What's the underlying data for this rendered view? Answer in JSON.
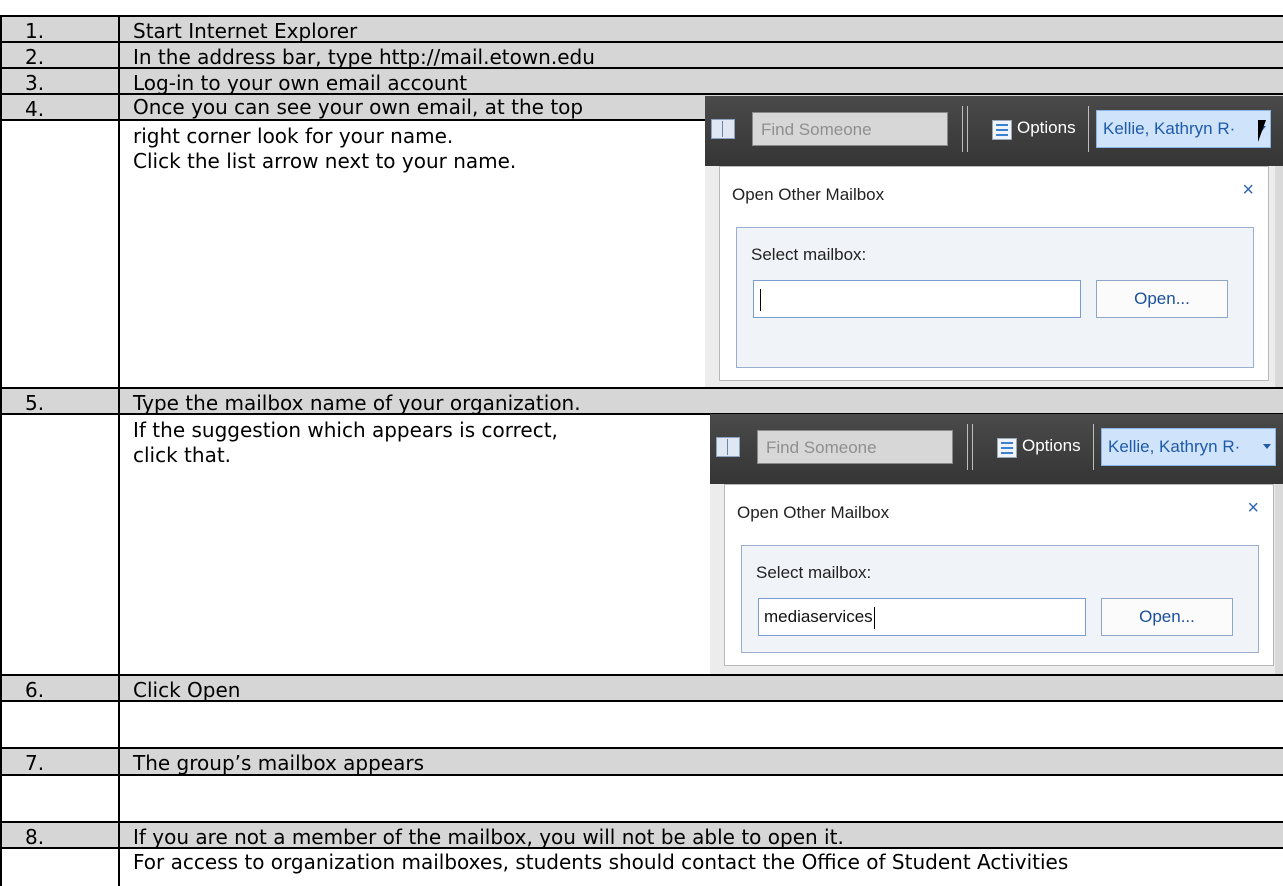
{
  "steps": [
    {
      "number": "1.",
      "lines": [
        "Start Internet Explorer"
      ]
    },
    {
      "number": "2.",
      "lines": [
        "In the address bar, type  http://mail.etown.edu"
      ]
    },
    {
      "number": "3.",
      "lines": [
        "Log-in to your own email account"
      ]
    },
    {
      "number": "4.",
      "lines": [
        "Once you can see your own email, at the top",
        "right corner look for your name.",
        "Click the list arrow next to your name."
      ]
    },
    {
      "number": "5.",
      "lines": [
        "Type the mailbox name of your organization.",
        "If the suggestion which appears is correct,",
        "click that."
      ]
    },
    {
      "number": "6.",
      "lines": [
        "Click Open"
      ]
    },
    {
      "number": "7.",
      "lines": [
        "The group’s mailbox appears"
      ]
    },
    {
      "number": "8.",
      "lines": [
        "If you are not a member of the mailbox, you will not be able to open it.",
        "For access to organization mailboxes, students should contact the Office of Student Activities"
      ]
    }
  ],
  "screenshots": [
    {
      "find_placeholder": "Find Someone",
      "options_label": "Options",
      "user_name": "Kellie, Kathryn R·",
      "dialog_title": "Open Other Mailbox",
      "close_glyph": "×",
      "select_label": "Select mailbox:",
      "mailbox_value": "",
      "open_button": "Open..."
    },
    {
      "find_placeholder": "Find Someone",
      "options_label": "Options",
      "user_name": "Kellie, Kathryn R·",
      "dialog_title": "Open Other Mailbox",
      "close_glyph": "×",
      "select_label": "Select mailbox:",
      "mailbox_value": "mediaservices",
      "open_button": "Open..."
    }
  ],
  "icons": {
    "address_book": "address-book-icon",
    "options": "options-list-icon",
    "dropdown": "chevron-down-icon",
    "pointer": "mouse-pointer-icon",
    "close": "close-icon"
  },
  "colors": {
    "header_shade": "#d6d6d6",
    "owa_bar": "#3d3d3d",
    "user_button": "#cfe3fb",
    "link_blue": "#1f5ba8"
  }
}
